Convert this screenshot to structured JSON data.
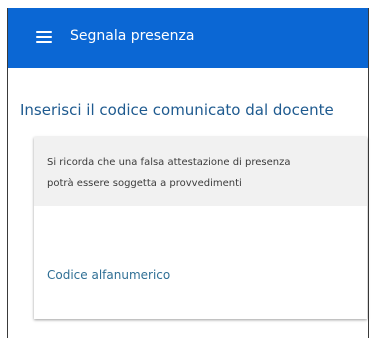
{
  "appbar": {
    "title": "Segnala presenza",
    "menu_icon": "hamburger-menu-icon",
    "background": "#0b67d4"
  },
  "main": {
    "heading": "Inserisci il codice comunicato dal docente",
    "notice": {
      "line1": "Si ricorda che una falsa attestazione di presenza",
      "line2": "potrà essere soggetta a provvedimenti"
    },
    "code_field": {
      "placeholder": "Codice alfanumerico"
    }
  }
}
